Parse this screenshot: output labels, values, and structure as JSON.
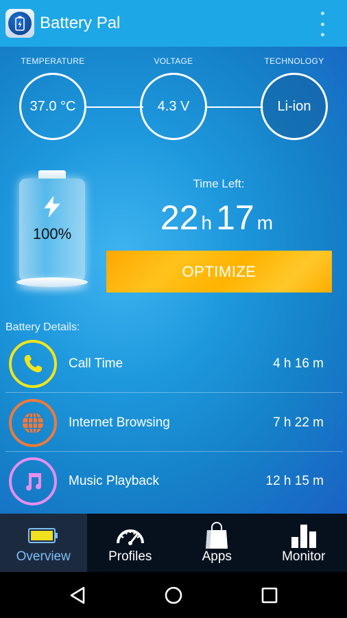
{
  "app": {
    "title": "Battery Pal"
  },
  "stats": [
    {
      "label": "TEMPERATURE",
      "value": "37.0 °C"
    },
    {
      "label": "VOLTAGE",
      "value": "4.3 V"
    },
    {
      "label": "TECHNOLOGY",
      "value": "Li-ion"
    }
  ],
  "battery": {
    "percent_text": "100%",
    "level": 1.0
  },
  "time_left": {
    "label": "Time Left:",
    "hours": "22",
    "hours_unit": "h",
    "minutes": "17",
    "minutes_unit": "m"
  },
  "optimize": {
    "label": "OPTIMIZE"
  },
  "details": {
    "label": "Battery Details:",
    "items": [
      {
        "name": "Call Time",
        "time": "4 h 16 m",
        "icon": "phone-icon",
        "color": "#f2e51a"
      },
      {
        "name": "Internet Browsing",
        "time": "7 h 22 m",
        "icon": "globe-icon",
        "color": "#f07a3a"
      },
      {
        "name": "Music Playback",
        "time": "12 h 15 m",
        "icon": "music-note-icon",
        "color": "#e58ef0"
      }
    ]
  },
  "bottom_nav": [
    {
      "label": "Overview",
      "icon": "battery-icon",
      "active": true
    },
    {
      "label": "Profiles",
      "icon": "speedometer-icon",
      "active": false
    },
    {
      "label": "Apps",
      "icon": "shopping-bag-icon",
      "active": false
    },
    {
      "label": "Monitor",
      "icon": "bar-chart-icon",
      "active": false
    }
  ],
  "colors": {
    "appbar": "#1ea7e6",
    "optimize": "#ffb300",
    "nav_bg": "#07111e",
    "nav_active": "#1c2a40"
  }
}
